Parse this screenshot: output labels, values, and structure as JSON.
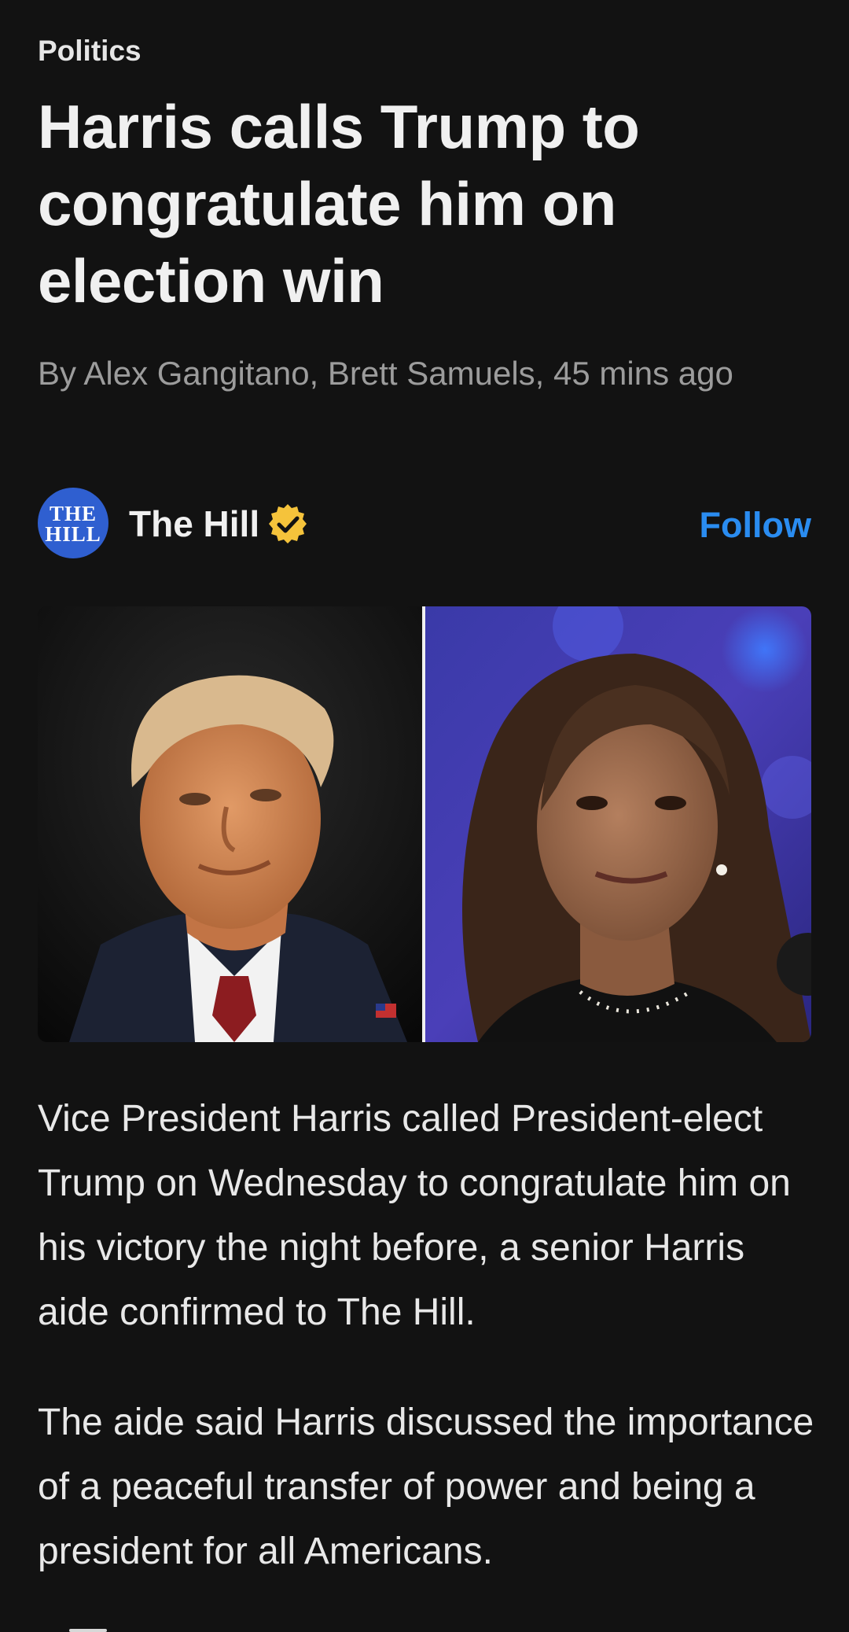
{
  "article": {
    "category": "Politics",
    "headline": "Harris calls Trump to congratulate him on election win",
    "byline": "By Alex Gangitano, Brett Samuels, 45 mins ago",
    "paragraphs": [
      "Vice President Harris called President-elect Trump on Wednesday to congratulate him on his victory the night before, a senior Harris aide confirmed to The Hill.",
      "The aide said Harris discussed the importance of a peaceful transfer of power and being a president for all Americans."
    ]
  },
  "source": {
    "name": "The Hill",
    "logo_line1": "THE",
    "logo_line2": "HILL",
    "follow_label": "Follow",
    "verified_icon": "verified-badge-icon"
  },
  "colors": {
    "background": "#121212",
    "text_primary": "#f0f0f0",
    "text_secondary": "#9c9c9c",
    "accent": "#2a8cf0",
    "verified_badge": "#f5c33b",
    "logo_bg": "#2f5fd0"
  }
}
